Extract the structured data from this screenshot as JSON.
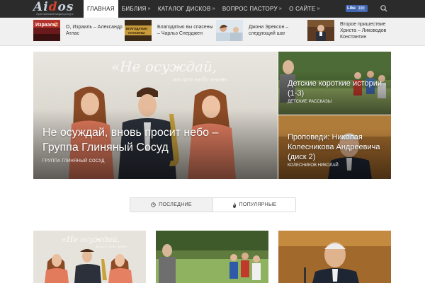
{
  "logo": {
    "text_main": "Ai",
    "text_accent": "d",
    "text_end": "os",
    "subtitle": "Христианский медиа-ресурс"
  },
  "nav": {
    "items": [
      {
        "label": "ГЛАВНАЯ",
        "active": true,
        "has_dropdown": false
      },
      {
        "label": "БИБЛИЯ",
        "active": false,
        "has_dropdown": true
      },
      {
        "label": "КАТАЛОГ ДИСКОВ",
        "active": false,
        "has_dropdown": true
      },
      {
        "label": "ВОПРОС ПАСТОРУ",
        "active": false,
        "has_dropdown": true
      },
      {
        "label": "О САЙТЕ",
        "active": false,
        "has_dropdown": true
      }
    ],
    "fb_like_label": "Like",
    "fb_like_count": "190"
  },
  "ticker": [
    {
      "title": "О, Израиль – Александр Атлас",
      "thumb_text": "Израэль!"
    },
    {
      "title": "Благодатью вы спасены – Чарльз Сперджен",
      "thumb_text": "БЛАГОДАТЬЮ СПАСЕНЫ"
    },
    {
      "title": "Джони Эрексон – следующий шаг",
      "thumb_text": ""
    },
    {
      "title": "Второе пришествие Христа – Лиководов Константин",
      "thumb_text": ""
    }
  ],
  "hero": {
    "main": {
      "overlay_text": "«Не осуждай,",
      "overlay_sub": "молит небо вновь",
      "title": "Не осуждай, вновь просит небо – Группа Глиняный Сосуд",
      "category": "ГРУППА ГЛИНЯНЫЙ СОСУД"
    },
    "side": [
      {
        "title": "Детские короткие истории (1-3)",
        "category": "ДЕТСКИЕ РАССКАЗЫ"
      },
      {
        "title": "Проповеди: Николая Колесникова Андреевича (диск 2)",
        "category": "КОЛЕСНИКОВ НИКОЛАЙ"
      }
    ]
  },
  "tabs": [
    {
      "label": "ПОСЛЕДНИЕ",
      "icon": "clock-icon",
      "active": true
    },
    {
      "label": "ПОПУЛЯРНЫЕ",
      "icon": "flame-icon",
      "active": false
    }
  ],
  "cards": [
    {
      "overlay_text": "«Не осуждай,",
      "overlay_sub": "молит небо вновь"
    },
    {
      "overlay_text": "",
      "overlay_sub": ""
    },
    {
      "overlay_text": "",
      "overlay_sub": ""
    }
  ],
  "colors": {
    "topbar": "#2b2b2b",
    "fb_blue": "#4267b2",
    "ticker_bg": "#f0f0f0"
  }
}
